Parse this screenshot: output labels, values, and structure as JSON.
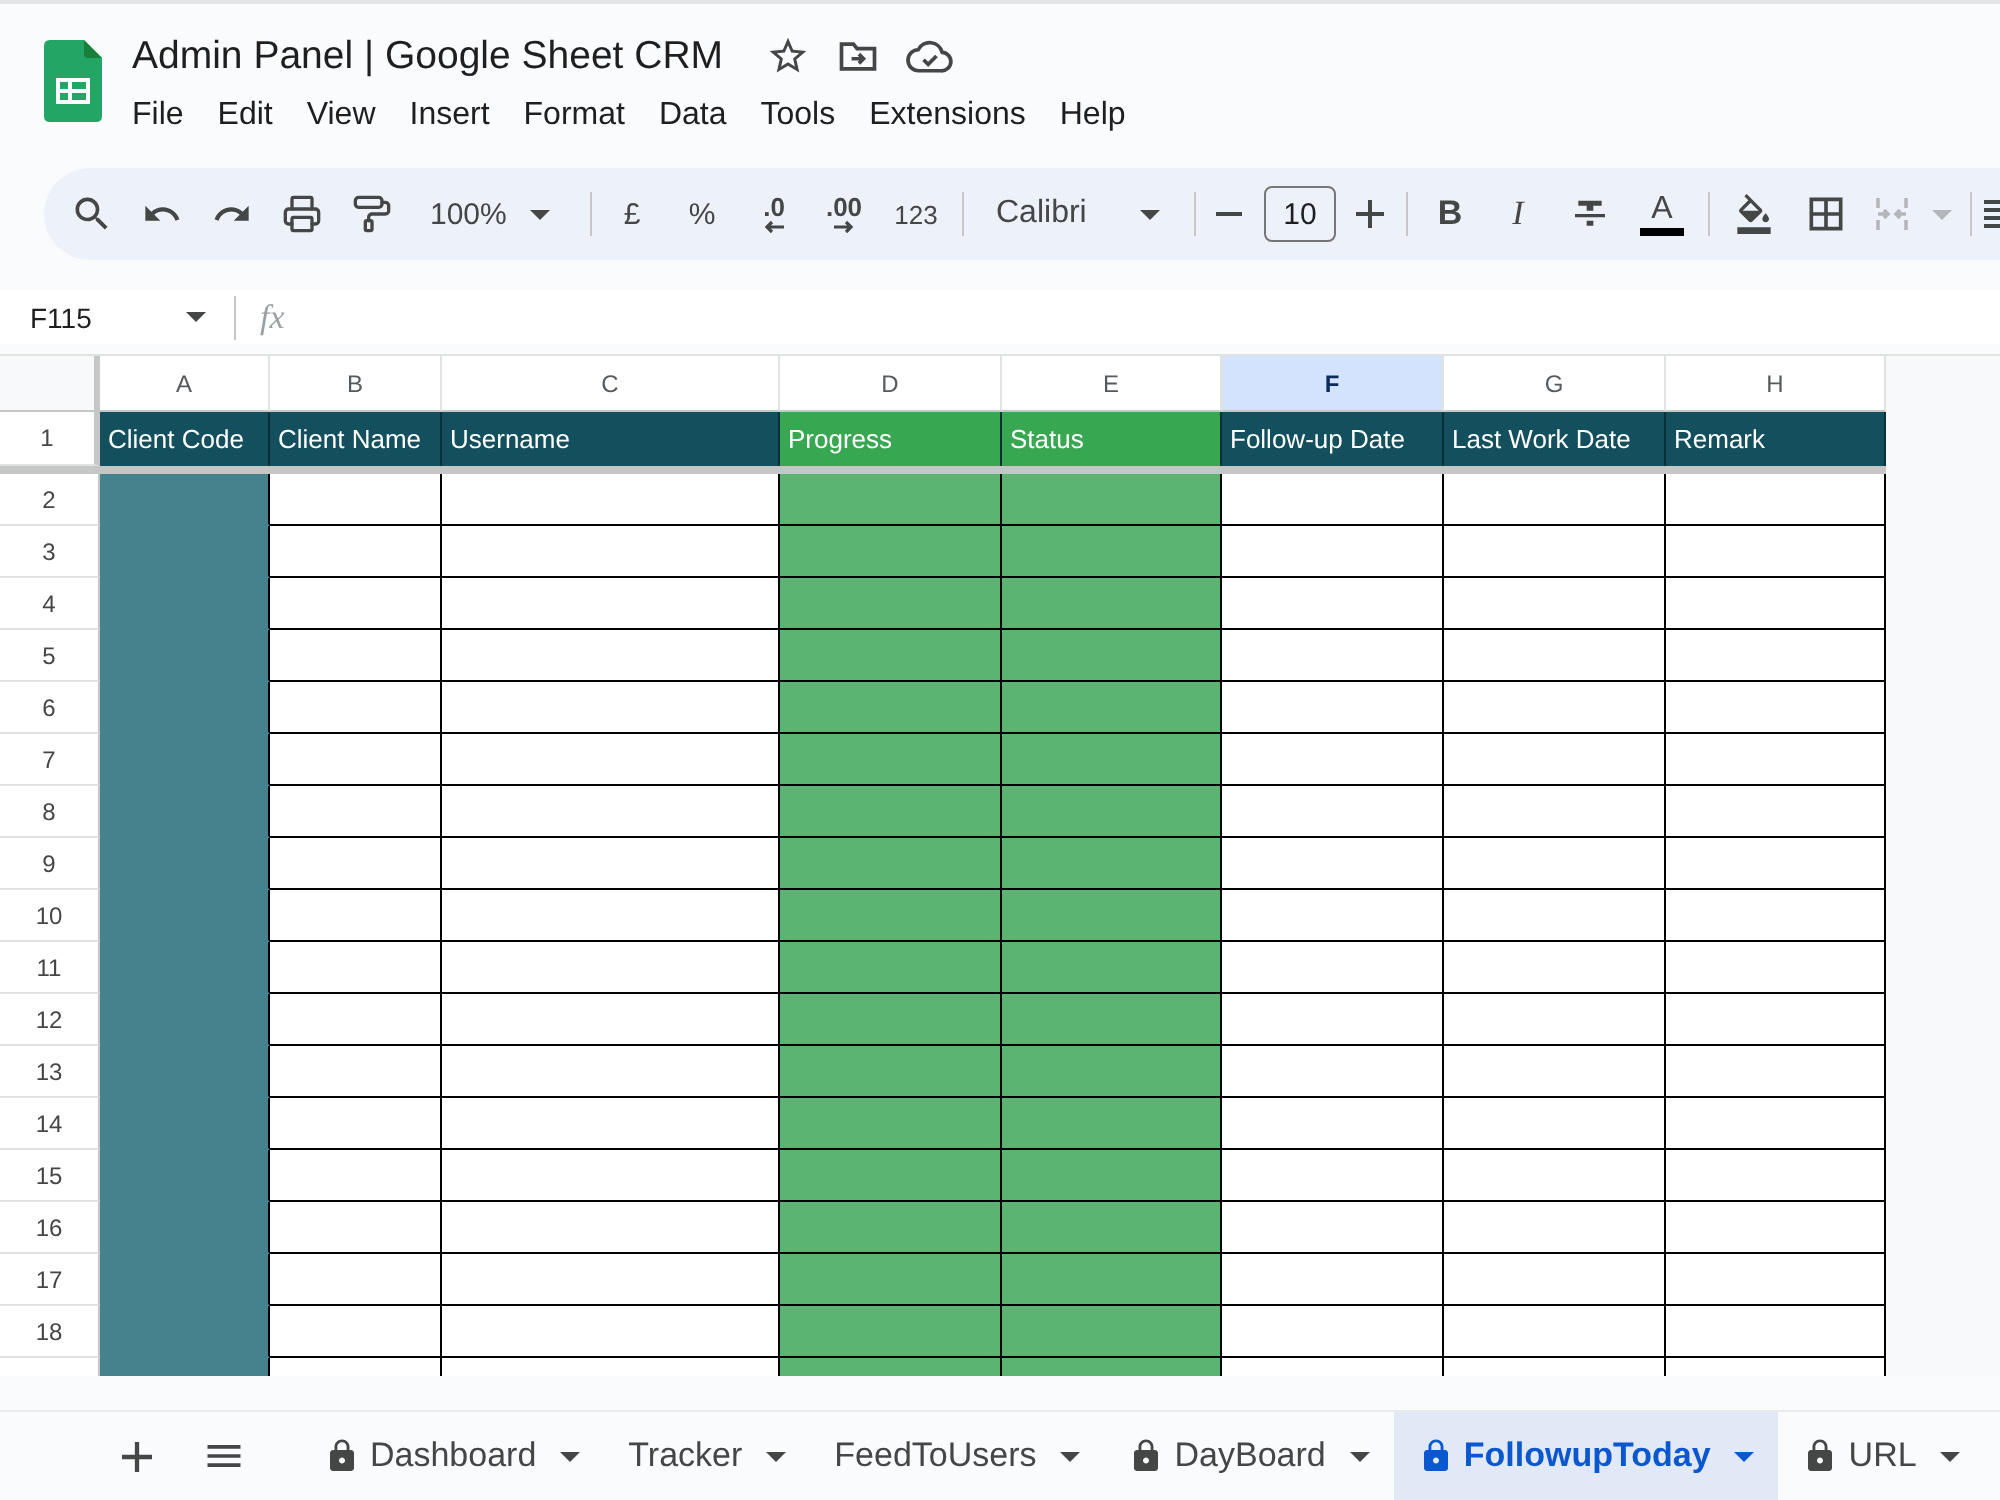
{
  "document": {
    "title": "Admin Panel | Google Sheet CRM",
    "menu": [
      "File",
      "Edit",
      "View",
      "Insert",
      "Format",
      "Data",
      "Tools",
      "Extensions",
      "Help"
    ]
  },
  "toolbar": {
    "zoom": "100%",
    "currency": "£",
    "percent": "%",
    "decrease_decimal": ".0",
    "increase_decimal": ".00",
    "number_format": "123",
    "font": "Calibri",
    "font_size": "10",
    "bold": "B",
    "italic": "I",
    "text_color": "A",
    "merge": {
      "disabled": true
    }
  },
  "formula_bar": {
    "cell_ref": "F115",
    "function_symbol": "fx"
  },
  "sheet": {
    "header_row": "1",
    "columns": [
      {
        "letter": "A",
        "header": "Client Code",
        "kind": "teal",
        "selected": false
      },
      {
        "letter": "B",
        "header": "Client Name",
        "kind": "plain",
        "selected": false
      },
      {
        "letter": "C",
        "header": "Username",
        "kind": "plain",
        "selected": false
      },
      {
        "letter": "D",
        "header": "Progress",
        "kind": "green",
        "selected": false
      },
      {
        "letter": "E",
        "header": "Status",
        "kind": "green",
        "selected": false
      },
      {
        "letter": "F",
        "header": "Follow-up Date",
        "kind": "plain",
        "selected": true
      },
      {
        "letter": "G",
        "header": "Last Work Date",
        "kind": "plain",
        "selected": false
      },
      {
        "letter": "H",
        "header": "Remark",
        "kind": "plain",
        "selected": false
      }
    ],
    "rows": [
      "2",
      "3",
      "4",
      "5",
      "6",
      "7",
      "8",
      "9",
      "10",
      "11",
      "12",
      "13",
      "14",
      "15",
      "16",
      "17",
      "18"
    ]
  },
  "sheet_tabs": [
    {
      "label": "Dashboard",
      "locked": true,
      "selected": false
    },
    {
      "label": "Tracker",
      "locked": false,
      "selected": false
    },
    {
      "label": "FeedToUsers",
      "locked": false,
      "selected": false
    },
    {
      "label": "DayBoard",
      "locked": true,
      "selected": false
    },
    {
      "label": "FollowupToday",
      "locked": true,
      "selected": true
    },
    {
      "label": "URL",
      "locked": true,
      "selected": false
    }
  ]
}
